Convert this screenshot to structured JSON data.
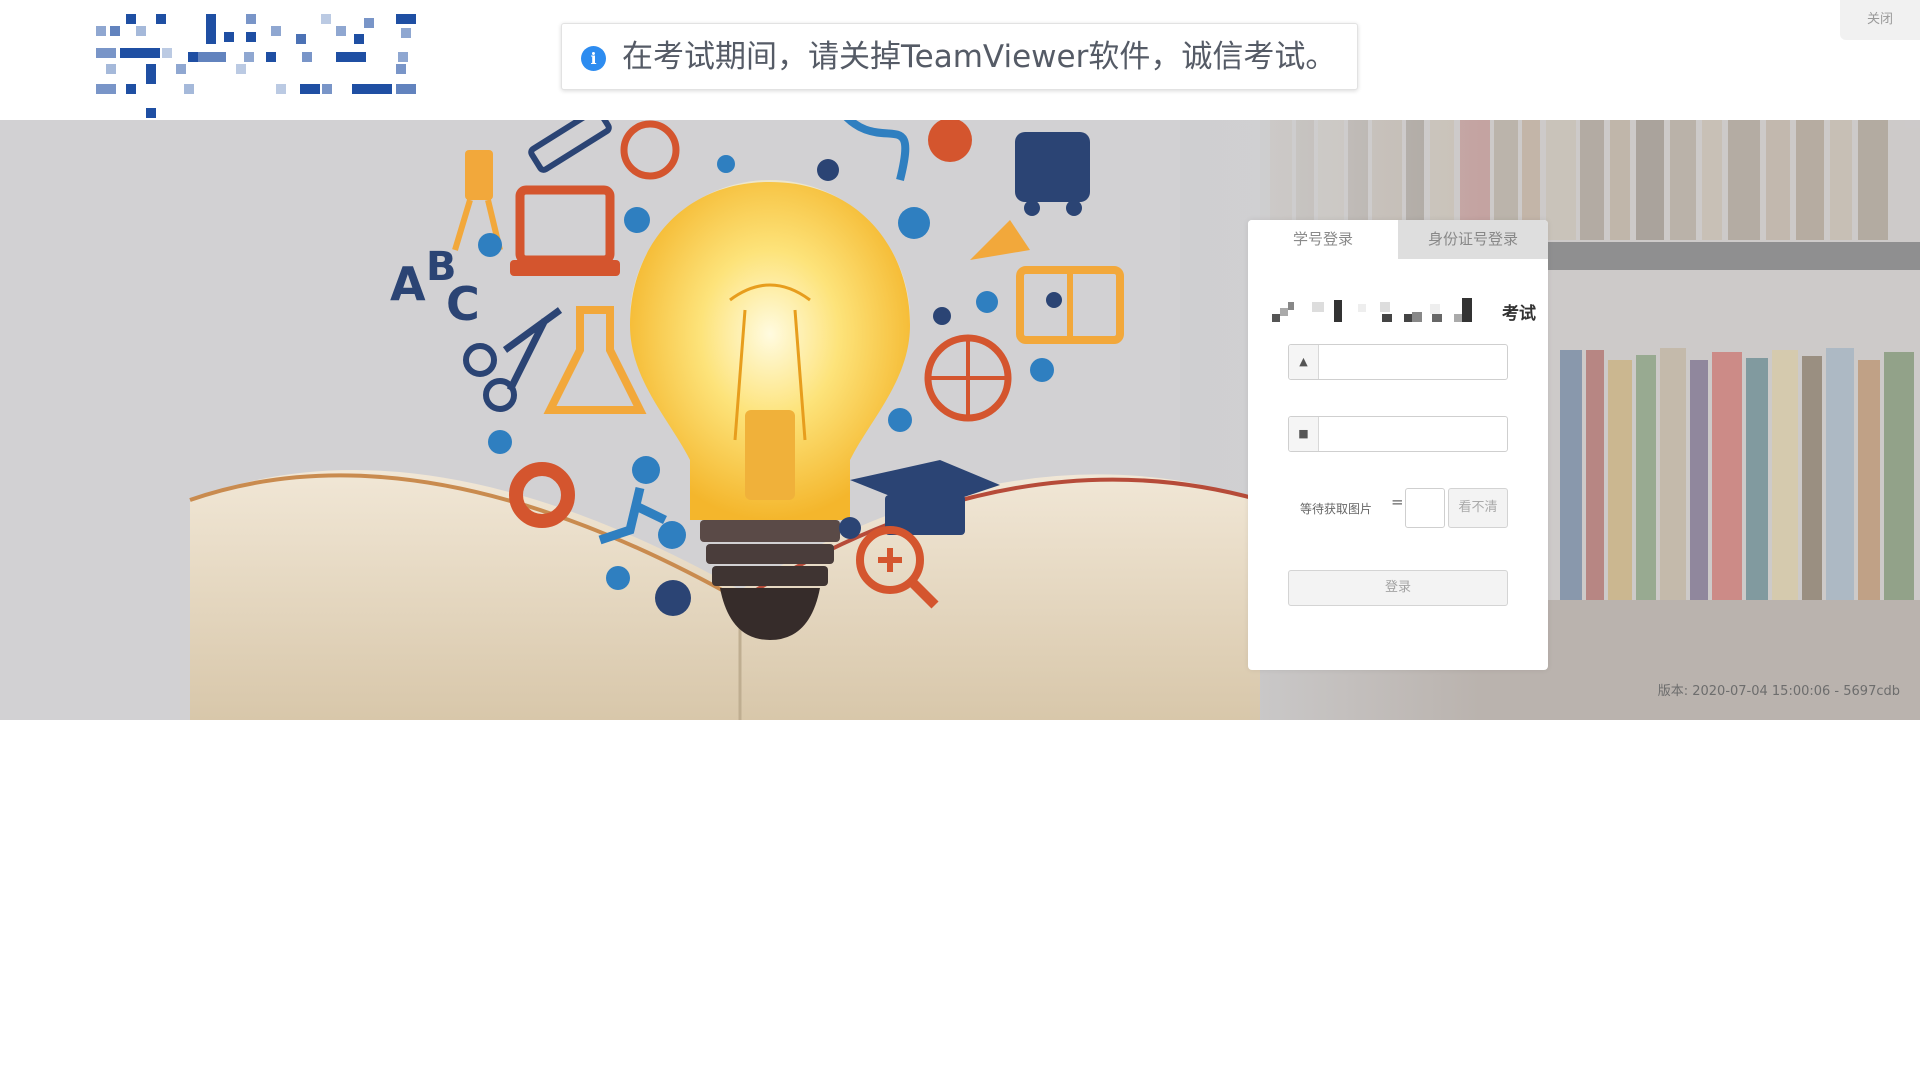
{
  "header": {
    "notice_icon": "i",
    "notice_text": "在考试期间，请关掉TeamViewer软件，诚信考试。",
    "close_label": "关闭",
    "logo_name": "pixelated-school-logo"
  },
  "login": {
    "tabs": [
      {
        "label": "学号登录",
        "active": true
      },
      {
        "label": "身份证号登录",
        "active": false
      }
    ],
    "exam_title_visible_text": "考试",
    "username": {
      "icon": "user-icon",
      "value": ""
    },
    "password": {
      "icon": "lock-icon",
      "value": ""
    },
    "captcha_label": "等待获取图片",
    "captcha_equals": "=",
    "captcha_value": "",
    "refresh_label": "看不清",
    "submit_label": "登录"
  },
  "footer": {
    "version_text": "版本: 2020-07-04 15:00:06 - 5697cdb"
  },
  "colors": {
    "accent": "#2d8cf0",
    "logo_blue": "#1f4fa3",
    "panel_bg": "#ffffff",
    "tab_inactive_bg": "#dedede"
  }
}
